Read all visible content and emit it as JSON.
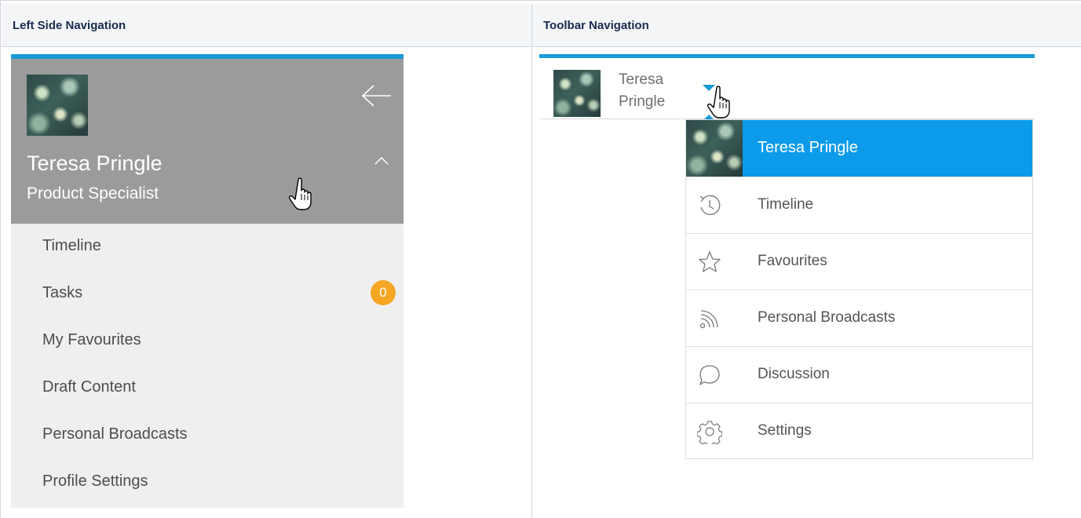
{
  "headers": {
    "left": "Left Side Navigation",
    "right": "Toolbar Navigation"
  },
  "left_nav": {
    "user_name": "Teresa Pringle",
    "user_role": "Product Specialist",
    "items": [
      {
        "label": "Timeline"
      },
      {
        "label": "Tasks",
        "badge": "0"
      },
      {
        "label": "My Favourites"
      },
      {
        "label": "Draft Content"
      },
      {
        "label": "Personal Broadcasts"
      },
      {
        "label": "Profile Settings"
      }
    ],
    "colors": {
      "accent": "#1a9ad8",
      "header_bg": "#9b9b9b",
      "list_bg": "#efefef",
      "badge": "#f5a623"
    }
  },
  "toolbar_nav": {
    "user_first": "Teresa",
    "user_last": "Pringle",
    "menu_header": "Teresa Pringle",
    "menu_items": [
      {
        "label": "Timeline",
        "icon": "history-icon"
      },
      {
        "label": "Favourites",
        "icon": "star-icon"
      },
      {
        "label": "Personal Broadcasts",
        "icon": "rss-icon"
      },
      {
        "label": "Discussion",
        "icon": "speech-bubble-icon"
      },
      {
        "label": "Settings",
        "icon": "gear-icon"
      }
    ],
    "colors": {
      "accent": "#1a9ad8",
      "menu_header_bg": "#0b9bea"
    }
  }
}
